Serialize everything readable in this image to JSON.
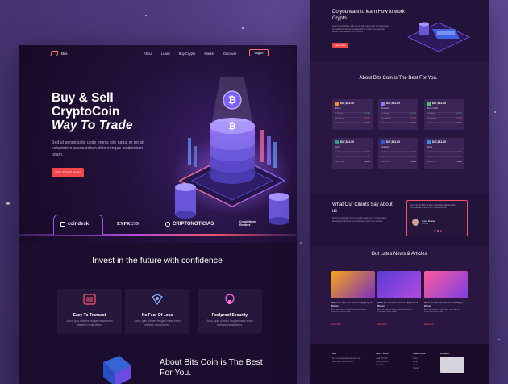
{
  "left": {
    "nav": {
      "logo": "Bits",
      "links": [
        "About",
        "Learn",
        "Buy Crypto",
        "Market",
        "Discover"
      ],
      "login": "Log in"
    },
    "hero": {
      "title_line1": "Buy & Sell",
      "title_line2": "CryptoCoin",
      "title_line3": "Way To Trade",
      "description": "Sed ut perspiciatis unde omnis iste natus er ror sit voluptatem accusantium dolore mque laudantium totam.",
      "cta": "GET START NOW"
    },
    "brands": [
      "coindesk",
      "EXPRESS",
      "CRIPTONOTICIAS",
      "CryptoNews Reuters"
    ],
    "invest_title": "Invest in the future with confidence",
    "features": [
      {
        "title": "Easy To Transact",
        "desc": "Arcu, quis ultrices feugiat mass enim ultricies consectetur."
      },
      {
        "title": "No Fear Of Loss",
        "desc": "Arcu, quis ultrices feugiat mass enim ultricies consectetur."
      },
      {
        "title": "Foolproof Security",
        "desc": "Arcu, quis ultrices feugiat mass enim ultricies consectetur."
      }
    ],
    "about_title": "About Bits Coin is The Best For You."
  },
  "right": {
    "learn": {
      "title": "Do you want to learn How to work Crypto",
      "desc": "Sed ut perspiciatis unde omnis iste natus error sit voluptatem accusantium doloremque laudantium totam rem aperiam eaque ipsa quae ab illo inventore.",
      "button": "Learn More"
    },
    "about_title": "About Bits Coin is The Best For You.",
    "coins": [
      {
        "price": "$47,541.00",
        "name": "Bitcoin",
        "color": "#f7931a"
      },
      {
        "price": "$47,541.00",
        "name": "Ethereum",
        "color": "#8b7cf0"
      },
      {
        "price": "$47,541.00",
        "name": "Bitcoin Cash",
        "color": "#4cc36a"
      },
      {
        "price": "$47,541.00",
        "name": "Tether",
        "color": "#26a17b"
      },
      {
        "price": "$47,541.00",
        "name": "Chainlink",
        "color": "#2a5ada"
      },
      {
        "price": "$47,541.00",
        "name": "Ripple",
        "color": "#3a8ee6"
      }
    ],
    "coin_labels": [
      "1h Change",
      "24h Change",
      "Market Cap"
    ],
    "coin_values": [
      "+0.76%",
      "-3.11%",
      "$880B"
    ],
    "clients": {
      "title": "What Our Clients Say About us",
      "desc": "Sed ut perspiciatis unde omnis iste natus error sit voluptatem accusantium doloremque laudantium totam rem aperiam.",
      "quote": "Lorem ipsum dolor sit amet, consectetur adipiscing elit. Pellentesque sit amet nibh in massa efficitur.",
      "name": "Anne Russel",
      "role": "Investor"
    },
    "news": {
      "title": "Out Lates News & Articles",
      "items": [
        {
          "title": "What You Need to Know to Spiking of Bitcoin",
          "desc": "Arcu, quis ultrices feugiat mass enim ultricies consectetur lorem ipsum.",
          "more": "Read More"
        },
        {
          "title": "What You Need to Know to Spiking of Bitcoin",
          "desc": "Arcu, quis ultrices feugiat mass enim ultricies consectetur lorem ipsum.",
          "more": "Read More"
        },
        {
          "title": "What You Need to Know to Spiking of Bitcoin",
          "desc": "Arcu, quis ultrices feugiat mass enim ultricies consectetur lorem ipsum.",
          "more": "Read More"
        }
      ]
    },
    "footer": {
      "logo": "Bits",
      "desc": "Sed ut perspiciatis unde omnis iste natus error sit voluptatem.",
      "col2_head": "Get in touch",
      "col2_items": [
        "+123 456 789",
        "hello@bits.com",
        "New York"
      ],
      "col3_head": "Useful links",
      "col3_items": [
        "About",
        "Market",
        "Learn",
        "Contact"
      ],
      "col4_head": "Location"
    }
  },
  "colors": {
    "accent": "#f0454b",
    "purple": "#9c55e0",
    "background": "#5b4590"
  }
}
